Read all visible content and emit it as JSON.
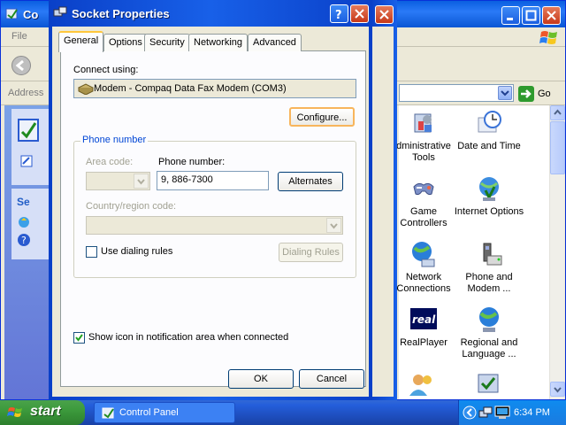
{
  "background_window": {
    "title": "Control Panel",
    "title_visible": "Co",
    "menu": {
      "file": "File"
    },
    "address_label": "Address",
    "go_label": "Go",
    "taskpane_label": "Se",
    "items": [
      {
        "label": "Administrative Tools",
        "visible_label": "dministrative\nTools",
        "icon": "admin-tools-icon"
      },
      {
        "label": "Date and Time",
        "icon": "clock-icon"
      },
      {
        "label": "Game Controllers",
        "icon": "gamepad-icon"
      },
      {
        "label": "Internet Options",
        "icon": "globe-shield-icon"
      },
      {
        "label": "Network Connections",
        "icon": "network-globe-icon"
      },
      {
        "label": "Phone and Modem ...",
        "icon": "phone-modem-icon"
      },
      {
        "label": "RealPlayer",
        "icon": "realplayer-icon"
      },
      {
        "label": "Regional and Language ...",
        "icon": "regional-globe-icon"
      }
    ]
  },
  "dialog": {
    "title": "Socket Properties",
    "tabs": [
      {
        "label": "General",
        "active": true
      },
      {
        "label": "Options",
        "active": false
      },
      {
        "label": "Security",
        "active": false
      },
      {
        "label": "Networking",
        "active": false
      },
      {
        "label": "Advanced",
        "active": false
      }
    ],
    "connect_using_label": "Connect using:",
    "device_name": "Modem - Compaq Data Fax Modem (COM3)",
    "configure_label": "Configure...",
    "phone_group_label": "Phone number",
    "area_code_label": "Area code:",
    "phone_number_label": "Phone number:",
    "phone_number_value": "9, 886-7300",
    "alternates_label": "Alternates",
    "country_label": "Country/region code:",
    "use_dialing_rules_label": "Use dialing rules",
    "use_dialing_rules_checked": false,
    "dialing_rules_label": "Dialing Rules",
    "show_icon_label": "Show icon in notification area when connected",
    "show_icon_checked": true,
    "ok_label": "OK",
    "cancel_label": "Cancel"
  },
  "taskbar": {
    "start_label": "start",
    "task_label": "Control Panel",
    "clock": "6:34 PM"
  },
  "colors": {
    "xp_blue": "#0a56d4",
    "dialog_face": "#ece9d8",
    "start_green": "#3c9a3c",
    "tab_highlight": "#ffc73c"
  }
}
